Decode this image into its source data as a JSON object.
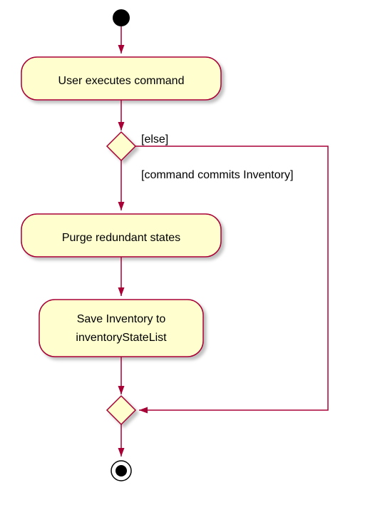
{
  "nodes": {
    "start": {
      "type": "start"
    },
    "a1": {
      "label": "User executes command"
    },
    "d1": {
      "type": "decision"
    },
    "a2": {
      "label": "Purge redundant states"
    },
    "a3": {
      "label_line1": "Save Inventory to",
      "label_line2": "inventoryStateList"
    },
    "d2": {
      "type": "merge"
    },
    "end": {
      "type": "end"
    }
  },
  "guards": {
    "else": "[else]",
    "commits": "[command commits Inventory]"
  }
}
